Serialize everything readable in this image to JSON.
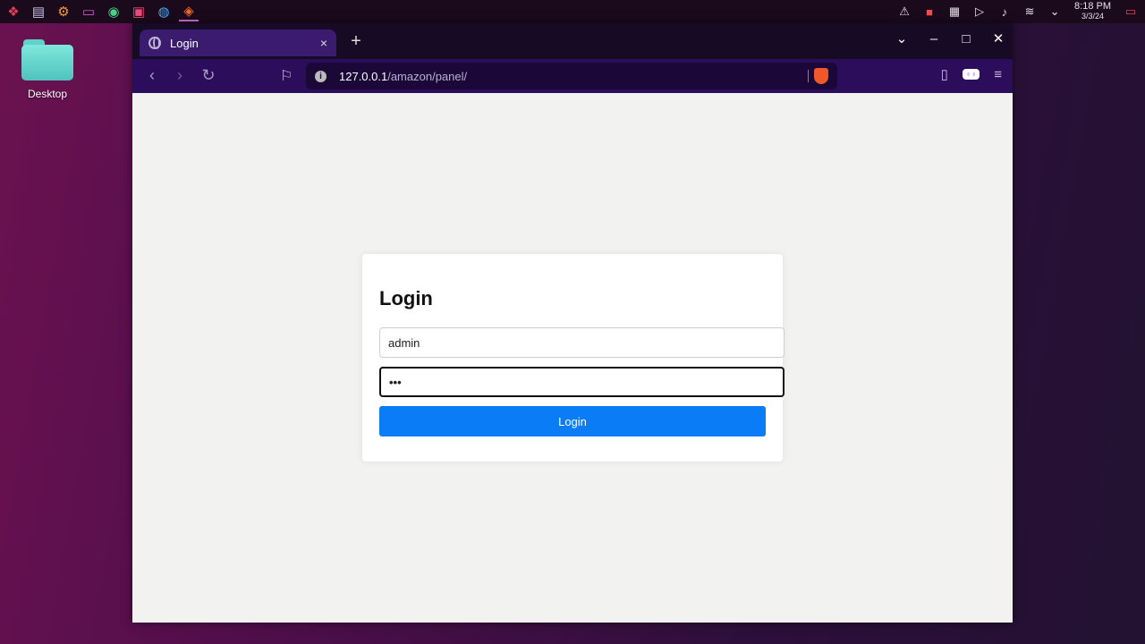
{
  "taskbar": {
    "apps": [
      {
        "icon": "app-launcher-icon"
      },
      {
        "icon": "window-switcher-icon"
      },
      {
        "icon": "settings-icon"
      },
      {
        "icon": "files-icon"
      },
      {
        "icon": "chromium-icon"
      },
      {
        "icon": "terminal-icon"
      },
      {
        "icon": "tor-icon"
      },
      {
        "icon": "brave-icon"
      }
    ],
    "clock": {
      "time": "8:18 PM",
      "date": "3/3/24"
    }
  },
  "desktop": {
    "folder_label": "Desktop"
  },
  "browser": {
    "tab": {
      "title": "Login",
      "close": "×"
    },
    "new_tab": "+",
    "url": {
      "host": "127.0.0.1",
      "path": "/amazon/panel/"
    }
  },
  "login": {
    "title": "Login",
    "username_value": "admin",
    "password_value": "•••",
    "button_label": "Login"
  },
  "colors": {
    "accent": "#0a7cf5",
    "toolbar": "#2b0d5c",
    "tab_active": "#3a1b6e"
  }
}
